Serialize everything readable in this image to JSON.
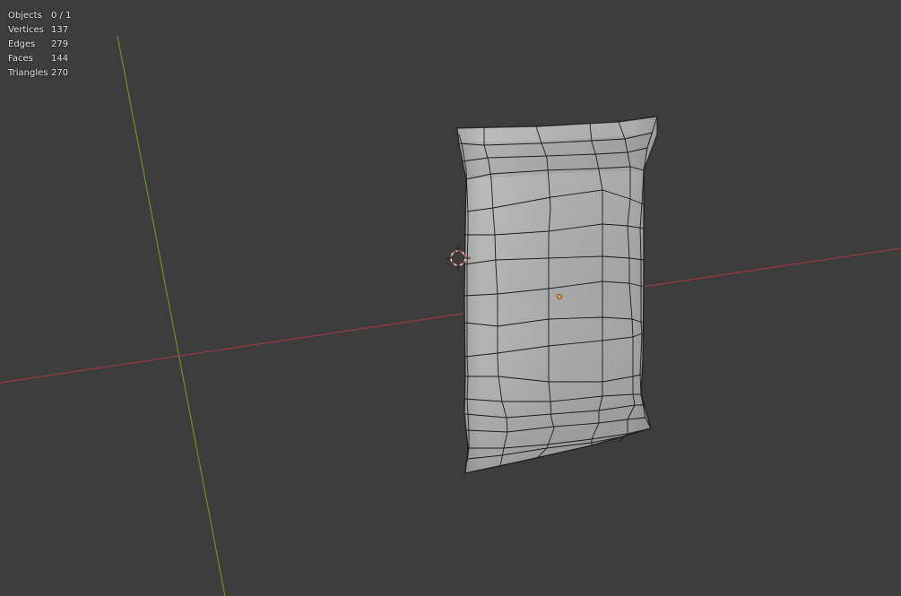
{
  "viewport": {
    "background_color": "#3d3d3d",
    "x_axis_color": "#9b3a44",
    "y_axis_color": "#6f9228",
    "mesh_fill_color": "#a6a6a6",
    "mesh_edge_color": "#1a1a1a",
    "origin_dot_color": "#f29a1f",
    "cursor_color": "#d9d9d9",
    "cursor_accent_color": "#c43a3a"
  },
  "stats": {
    "objects_label": "Objects",
    "objects_value": "0 / 1",
    "vertices_label": "Vertices",
    "vertices_value": "137",
    "edges_label": "Edges",
    "edges_value": "279",
    "faces_label": "Faces",
    "faces_value": "144",
    "triangles_label": "Triangles",
    "triangles_value": "270"
  }
}
